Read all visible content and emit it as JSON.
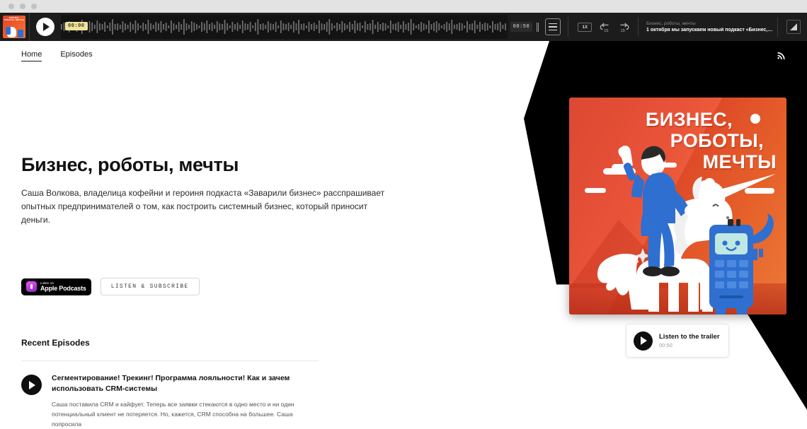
{
  "window": {
    "dots": 3
  },
  "player": {
    "cover_mini_title": "БИЗНЕС, РОБОТЫ, МЕЧТЫ",
    "current_time": "00:00",
    "duration": "00:50",
    "speed_label": "1X",
    "skip_back_label": "15",
    "skip_forward_label": "15",
    "show_name": "Бизнес, роботы, мечты",
    "episode_title": "1 октября мы запускаем новый подкаст «Бизнес,…",
    "play_icon": "play-icon",
    "menu_icon": "playlist-menu-icon",
    "expand_icon": "expand-icon",
    "volume_icon": "volume-icon"
  },
  "nav": {
    "items": [
      {
        "label": "Home",
        "active": true
      },
      {
        "label": "Episodes",
        "active": false
      }
    ],
    "rss_icon": "rss-icon"
  },
  "hero": {
    "title": "Бизнес, роботы, мечты",
    "description": "Саша Волкова, владелица кофейни и героиня подкаста «Заварили бизнес» расспрашивает опытных предпринимателей о том, как построить системный бизнес, который приносит деньги."
  },
  "cta": {
    "apple_small": "Listen on",
    "apple_large": "Apple Podcasts",
    "subscribe_label": "LISTEN & SUBSCRIBE"
  },
  "cover_art": {
    "line1": "БИЗНЕС,",
    "line2": "РОБОТЫ,",
    "line3": "МЕЧТЫ",
    "bg_color": "#e8472a",
    "accent_color": "#f8803b"
  },
  "trailer": {
    "label": "Listen to the trailer",
    "duration": "00:50",
    "play_icon": "play-icon"
  },
  "recent": {
    "heading": "Recent Episodes",
    "episodes": [
      {
        "title": "Сегментирование! Трекинг! Программа лояльности! Как и зачем использовать CRM-системы",
        "description": "Саша поставила CRM и кайфует. Теперь все заявки стекаются в одно место и ни один потенциальный клиент не потеряется. Но, кажется, CRM способна на большее. Саша попросила"
      }
    ]
  }
}
